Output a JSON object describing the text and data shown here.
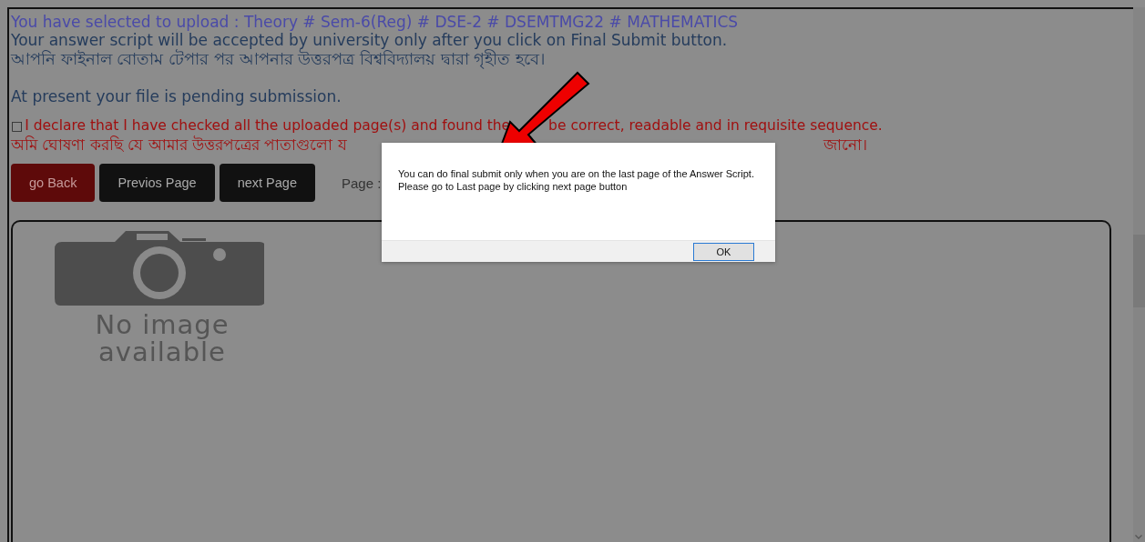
{
  "header": {
    "selection": "You have selected to upload : Theory # Sem-6(Reg) # DSE-2 # DSEMTMG22 # MATHEMATICS",
    "notice_en": "Your answer script will be accepted by university only after you click on Final Submit button.",
    "notice_bn": "আপনি ফাইনাল বোতাম টেপার পর আপনার উত্তরপত্র বিশ্ববিদ্যালয় দ্বারা গৃহীত হবে।",
    "status": "At present your file is pending submission."
  },
  "declaration": {
    "checked": false,
    "box": "□",
    "text_en_start": "I declare that I have checked all the uploaded page(s) and found the",
    "text_en_end": "be correct, readable and in requisite sequence.",
    "text_bn_start": "অমি ঘোষণা করছি যে আমার উত্তরপত্রের পাতাগুলো য",
    "text_bn_end": "জানো।"
  },
  "buttons": [
    {
      "label": "go Back",
      "kind": "back"
    },
    {
      "label": "Previos Page",
      "kind": "nav"
    },
    {
      "label": "next Page",
      "kind": "nav"
    }
  ],
  "page_label": "Page :",
  "preview": {
    "line1": "No image",
    "line2": "available"
  },
  "dialog": {
    "message": "You can do final submit only when you are on the last page of the Answer Script.",
    "message2": "Please go to Last page by clicking next page button",
    "ok": "OK"
  }
}
